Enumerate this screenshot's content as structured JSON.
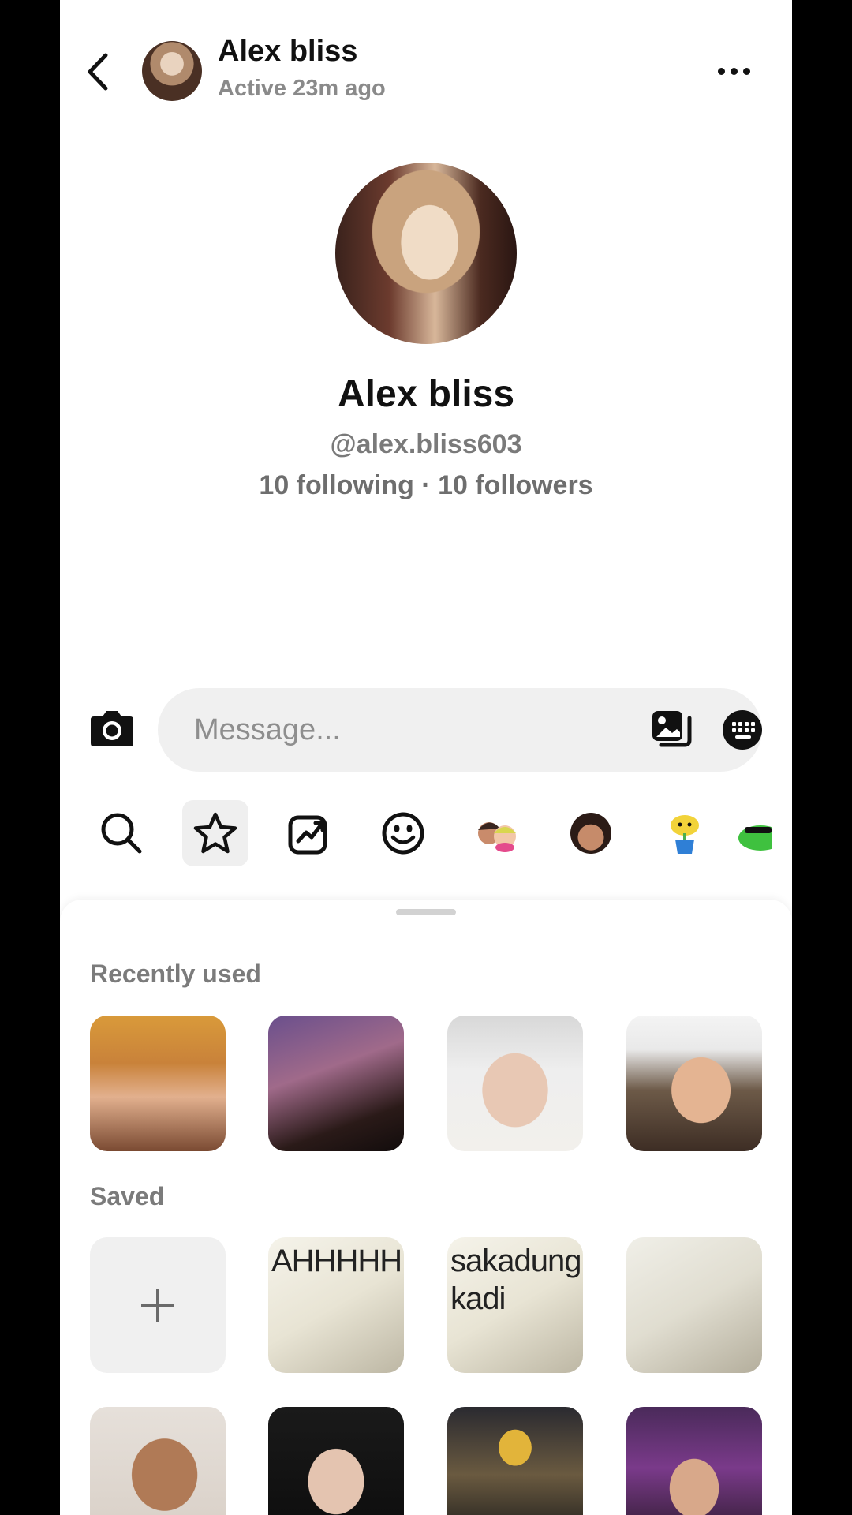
{
  "header": {
    "name": "Alex bliss",
    "status": "Active 23m ago"
  },
  "profile": {
    "name": "Alex bliss",
    "handle": "@alex.bliss603",
    "stats": "10 following · 10 followers"
  },
  "composer": {
    "placeholder": "Message..."
  },
  "sticker_tabs": [
    "search-icon",
    "star-icon",
    "trending-icon",
    "smiley-icon",
    "bitmoji-pair-icon",
    "avatar-face-icon",
    "plant-sticker-icon",
    "frog-sticker-icon"
  ],
  "sticker_sheet": {
    "recently_used_title": "Recently used",
    "saved_title": "Saved",
    "saved_text_1": "AHHHHH",
    "saved_text_2": "sakadung kadi"
  },
  "colors": {
    "background": "#ffffff",
    "secondary_text": "#7b7b7b",
    "input_background": "#f0f0f0",
    "icon": "#111111"
  }
}
